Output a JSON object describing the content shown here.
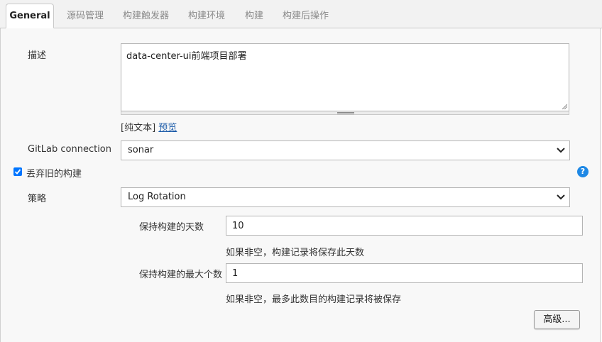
{
  "tabs": [
    {
      "label": "General"
    },
    {
      "label": "源码管理"
    },
    {
      "label": "构建触发器"
    },
    {
      "label": "构建环境"
    },
    {
      "label": "构建"
    },
    {
      "label": "构建后操作"
    }
  ],
  "description": {
    "label": "描述",
    "value": "data-center-ui前端项目部署",
    "format_prefix": "[纯文本]",
    "preview_link": "预览"
  },
  "gitlab": {
    "label": "GitLab connection",
    "selected": "sonar"
  },
  "discard_old_builds": {
    "label": "丢弃旧的构建",
    "checked": true
  },
  "strategy": {
    "label": "策略",
    "selected": "Log Rotation",
    "days_to_keep": {
      "label": "保持构建的天数",
      "value": "10",
      "hint": "如果非空，构建记录将保存此天数"
    },
    "max_builds": {
      "label": "保持构建的最大个数",
      "value": "1",
      "hint": "如果非空，最多此数目的构建记录将被保存"
    }
  },
  "advanced_button": "高级...",
  "help_icon": "?",
  "colors": {
    "link": "#1a5aa8",
    "checkbox": "#0075ff",
    "help": "#1e88e5"
  }
}
